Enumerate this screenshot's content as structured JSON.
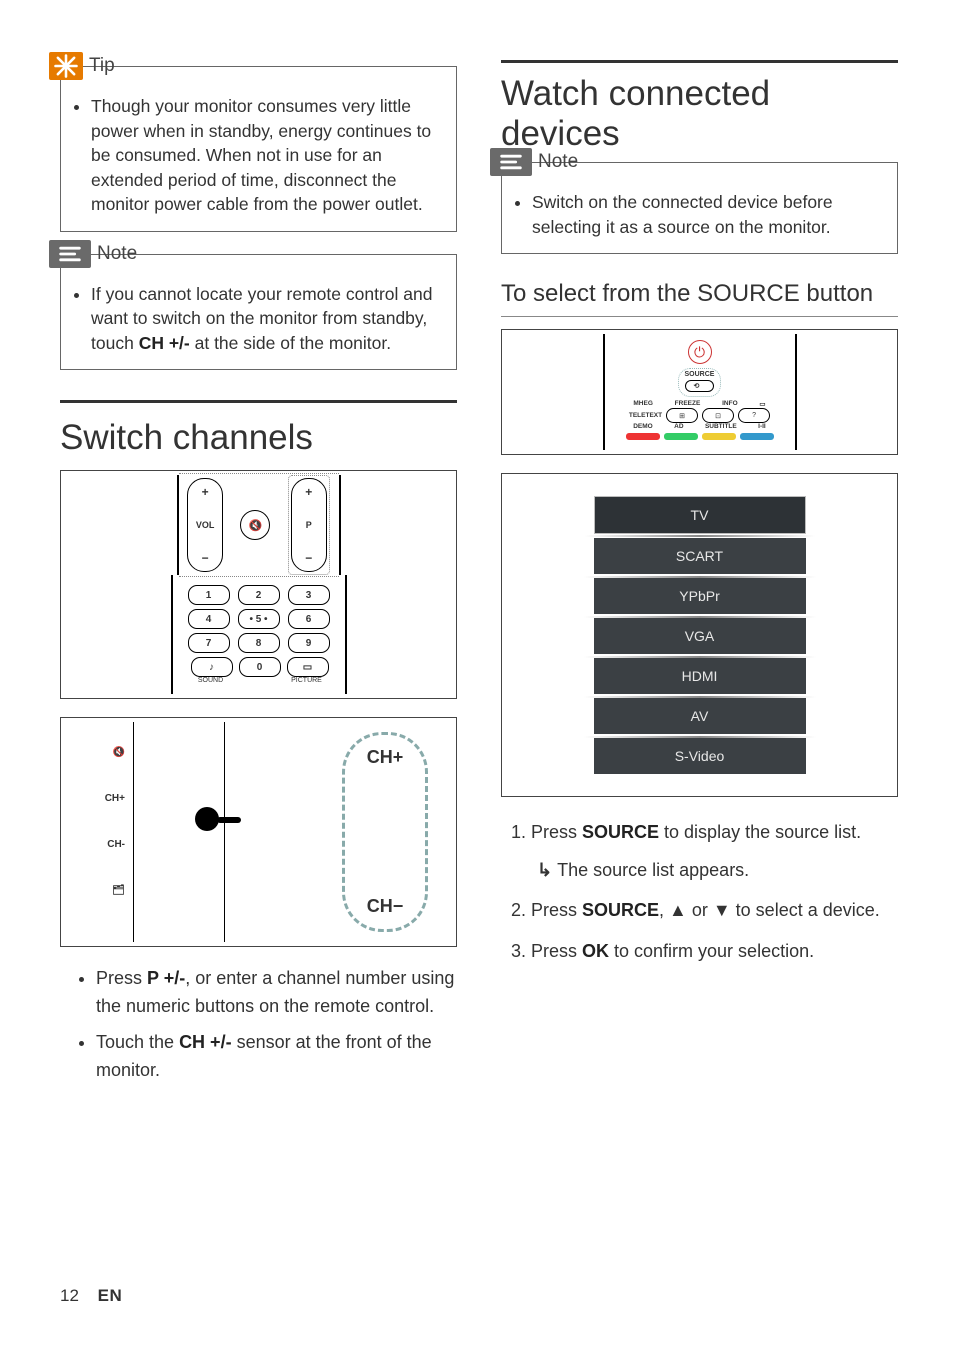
{
  "left": {
    "tip": {
      "title": "Tip",
      "text_a": "Though your monitor consumes very little power when in standby, energy continues to be consumed. When not in use for an extended period of time, disconnect the monitor power cable from the power outlet."
    },
    "note": {
      "title": "Note",
      "text_a": "If you cannot locate your remote control and want to switch on the monitor from standby, touch ",
      "text_b": "CH +/-",
      "text_c": " at the side of the monitor."
    },
    "section": "Switch channels",
    "remote": {
      "vol": "VOL",
      "p": "P",
      "mute": "🔇",
      "keys": [
        "1",
        "2",
        "3",
        "4",
        "• 5 •",
        "6",
        "7",
        "8",
        "9",
        "♪",
        "0",
        "▭"
      ],
      "sublabels": [
        "SOUND",
        "",
        "PICTURE"
      ]
    },
    "side": {
      "labels": [
        "🔇",
        "CH+",
        "CH-",
        "🗂"
      ],
      "chp": "CH+",
      "chm": "CH−"
    },
    "bullets": [
      {
        "a": "Press ",
        "b": "P +/-",
        "c": ", or enter a channel number using the numeric buttons on the remote control."
      },
      {
        "a": "Touch the ",
        "b": "CH +/-",
        "c": " sensor at the front of the monitor."
      }
    ]
  },
  "right": {
    "section": "Watch connected devices",
    "note": {
      "title": "Note",
      "text_a": "Switch on the connected device before selecting it as a source on the monitor."
    },
    "subsection": "To select from the SOURCE button",
    "remote": {
      "source": "SOURCE",
      "row1_labels": [
        "MHEG",
        "FREEZE",
        "INFO",
        ""
      ],
      "row1_left": "TELETEXT",
      "row2_labels": [
        "DEMO",
        "AD",
        "SUBTITLE",
        "I-II"
      ]
    },
    "sources": [
      "TV",
      "SCART",
      "YPbPr",
      "VGA",
      "HDMI",
      "AV",
      "S-Video"
    ],
    "steps": [
      {
        "a": "Press ",
        "b": "SOURCE",
        "c": " to display the source list.",
        "result": "The source list appears."
      },
      {
        "a": "Press ",
        "b": "SOURCE",
        "c": ", ▲ or ▼ to select a device."
      },
      {
        "a": "Press ",
        "b": "OK",
        "c": " to confirm your selection."
      }
    ]
  },
  "footer": {
    "page": "12",
    "lang": "EN"
  }
}
